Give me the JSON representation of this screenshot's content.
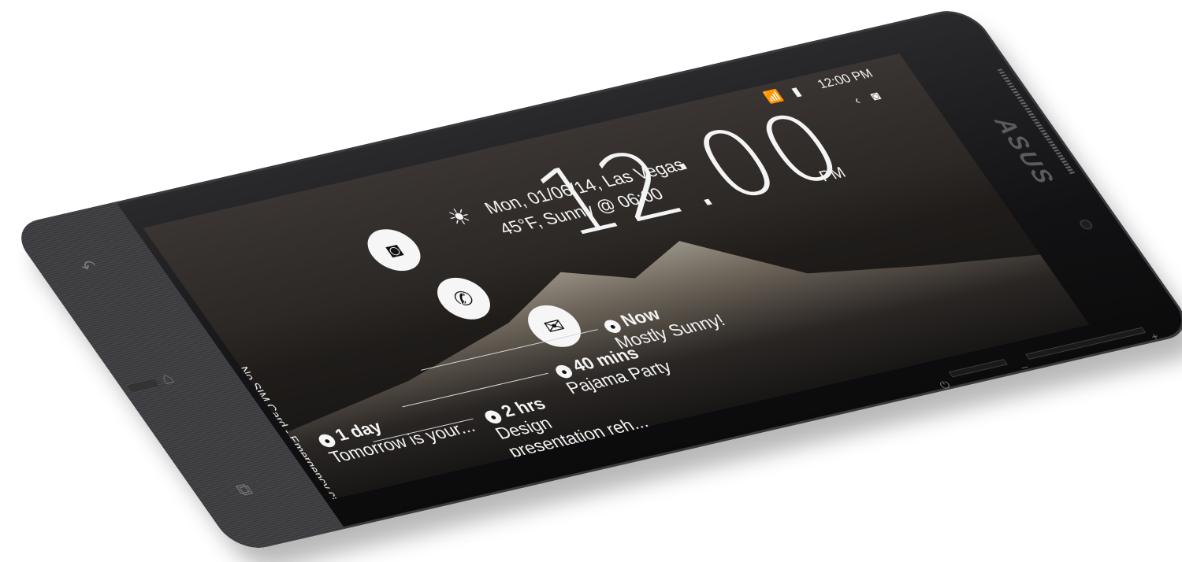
{
  "lockscreen": {
    "clock": "12:00",
    "ampm": "PM",
    "date_line": "Mon, 01/06/14, Las Vegas",
    "weather_line": "45°F, Sunny @ 06:00",
    "quick_actions": [
      {
        "icon": "camera-icon",
        "glyph": "◙"
      },
      {
        "icon": "phone-icon",
        "glyph": "✆"
      },
      {
        "icon": "mail-icon",
        "glyph": "✉"
      }
    ],
    "events": [
      {
        "time": "Now",
        "title": "Mostly Sunny!",
        "icon": "weather-icon"
      },
      {
        "time": "40 mins",
        "title": "Pajama Party",
        "icon": "clock-icon"
      },
      {
        "time": "2 hrs",
        "title": "Design presentation reh...",
        "icon": "people-icon"
      },
      {
        "time": "1 day",
        "title": "Tomorrow is your...",
        "icon": "people-icon"
      }
    ],
    "emergency_text": "No SIM Card - Emergency calls only"
  },
  "status_bar": {
    "time": "12:00 PM",
    "icons": [
      "wifi-icon",
      "battery-icon",
      "camera-icon"
    ]
  },
  "brand": "ASUS",
  "nav": {
    "back": "↶",
    "home": "⌂",
    "recent": "⧉"
  },
  "side_buttons": {
    "power": "⏻",
    "volume_down": "–",
    "volume_up": "+"
  }
}
